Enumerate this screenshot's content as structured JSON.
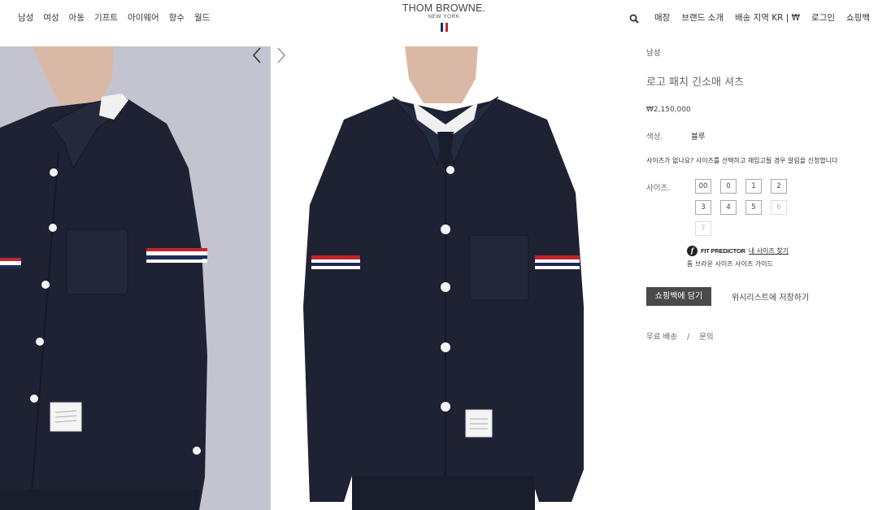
{
  "nav": {
    "left": [
      "남성",
      "여성",
      "아동",
      "기프트",
      "아이웨어",
      "향수",
      "월드"
    ],
    "right": [
      "매장",
      "브랜드 소개",
      "배송 지역 KR | ₩",
      "로그인",
      "쇼핑백"
    ]
  },
  "logo": {
    "brand": "THOM BROWNE.",
    "sub": "NEW YORK",
    "flag_colors": [
      "#1f2a5c",
      "#ffffff",
      "#c0262d"
    ]
  },
  "icons": {
    "search": "search-icon",
    "prev": "chevron-left-icon",
    "next": "chevron-right-icon",
    "fit": "fit-predictor-icon"
  },
  "product": {
    "breadcrumb": "남성",
    "title": "로고 패치 긴소매 셔츠",
    "price": "₩2,150,000",
    "color_label": "색상.",
    "color_value": "블루",
    "size_help": "사이즈가 없나요? 사이즈를 선택하고 재입고될 경우 알림을 신청합니다",
    "size_label": "사이즈.",
    "sizes": [
      {
        "label": "00",
        "available": true
      },
      {
        "label": "0",
        "available": true
      },
      {
        "label": "1",
        "available": true
      },
      {
        "label": "2",
        "available": true
      },
      {
        "label": "3",
        "available": true
      },
      {
        "label": "4",
        "available": true
      },
      {
        "label": "5",
        "available": true
      },
      {
        "label": "6",
        "available": false
      },
      {
        "label": "7",
        "available": false
      }
    ],
    "fit_predictor": "FIT PREDICTOR",
    "fit_link": "내 사이즈 찾기",
    "size_guide": "톰 브라운 사이즈 사이즈 가이드",
    "add_to_bag": "쇼핑백에 담기",
    "wishlist": "위시리스트에 저장하기",
    "free_shipping": "무료 배송",
    "separator": "/",
    "inquiry": "문의"
  },
  "colors": {
    "shirt": "#1e2233",
    "panel_bg": "#c4c5d0",
    "button": "#4a4a4a"
  }
}
